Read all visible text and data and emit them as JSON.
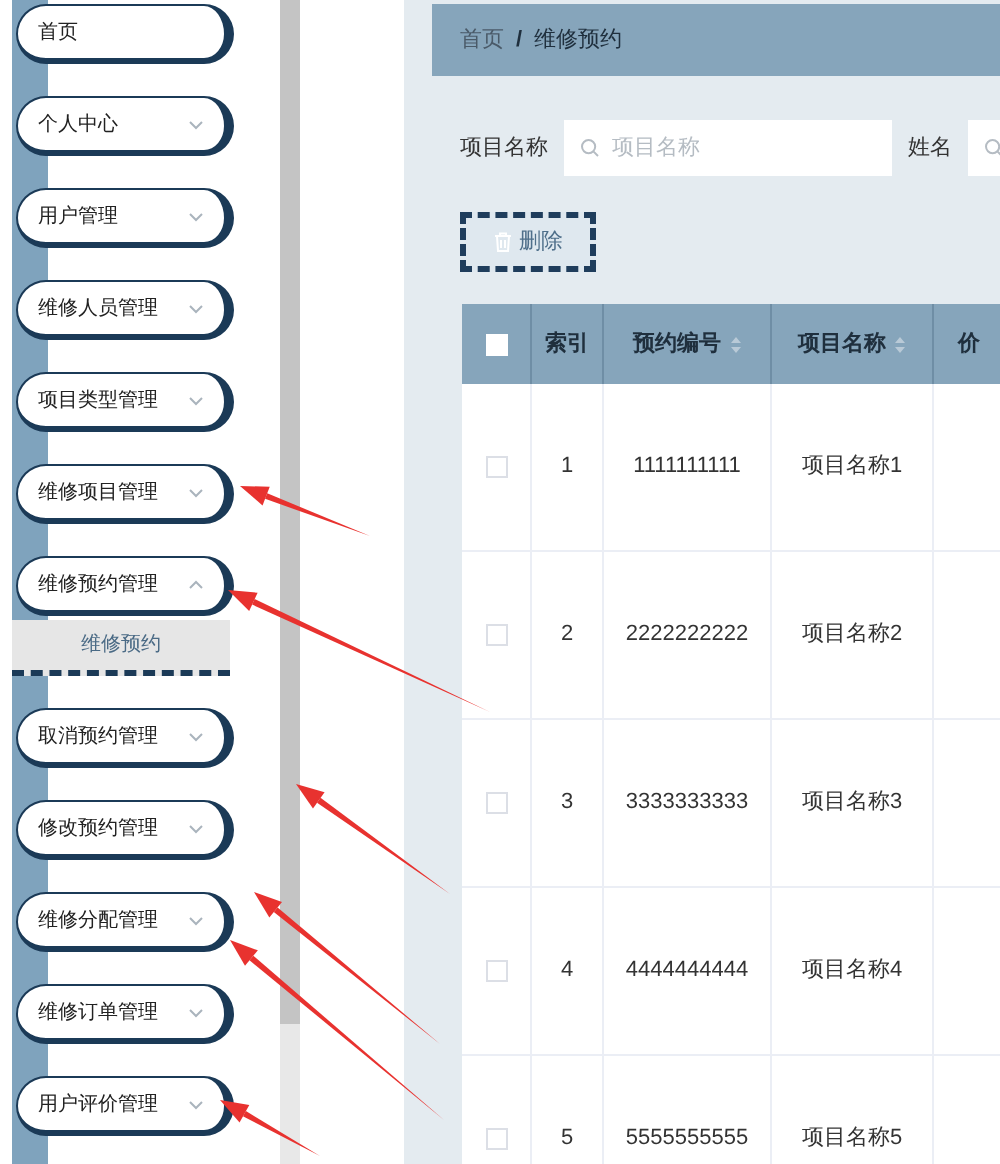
{
  "sidebar": {
    "items": [
      {
        "label": "首页",
        "kind": "link"
      },
      {
        "label": "个人中心",
        "kind": "group",
        "expanded": false
      },
      {
        "label": "用户管理",
        "kind": "group",
        "expanded": false
      },
      {
        "label": "维修人员管理",
        "kind": "group",
        "expanded": false
      },
      {
        "label": "项目类型管理",
        "kind": "group",
        "expanded": false
      },
      {
        "label": "维修项目管理",
        "kind": "group",
        "expanded": false
      },
      {
        "label": "维修预约管理",
        "kind": "group",
        "expanded": true,
        "children": [
          {
            "label": "维修预约",
            "selected": true
          }
        ]
      },
      {
        "label": "取消预约管理",
        "kind": "group",
        "expanded": false
      },
      {
        "label": "修改预约管理",
        "kind": "group",
        "expanded": false
      },
      {
        "label": "维修分配管理",
        "kind": "group",
        "expanded": false
      },
      {
        "label": "维修订单管理",
        "kind": "group",
        "expanded": false
      },
      {
        "label": "用户评价管理",
        "kind": "group",
        "expanded": false
      }
    ]
  },
  "breadcrumb": {
    "separator": "/",
    "items": [
      "首页",
      "维修预约"
    ]
  },
  "search": [
    {
      "label": "项目名称",
      "placeholder": "项目名称"
    },
    {
      "label": "姓名"
    }
  ],
  "toolbar": {
    "delete_button": "删除"
  },
  "table": {
    "header_checked": false,
    "columns": [
      {
        "label": "索引",
        "sortable": false
      },
      {
        "label": "预约编号",
        "sortable": true
      },
      {
        "label": "项目名称",
        "sortable": true
      },
      {
        "label": "价",
        "sortable": false
      }
    ],
    "rows": [
      {
        "checked": false,
        "cells": [
          "1",
          "1111111111",
          "项目名称1"
        ]
      },
      {
        "checked": false,
        "cells": [
          "2",
          "2222222222",
          "项目名称2"
        ]
      },
      {
        "checked": false,
        "cells": [
          "3",
          "3333333333",
          "项目名称3"
        ]
      },
      {
        "checked": false,
        "cells": [
          "4",
          "4444444444",
          "项目名称4"
        ]
      },
      {
        "checked": false,
        "cells": [
          "5",
          "5555555555",
          "项目名称5"
        ]
      }
    ]
  }
}
